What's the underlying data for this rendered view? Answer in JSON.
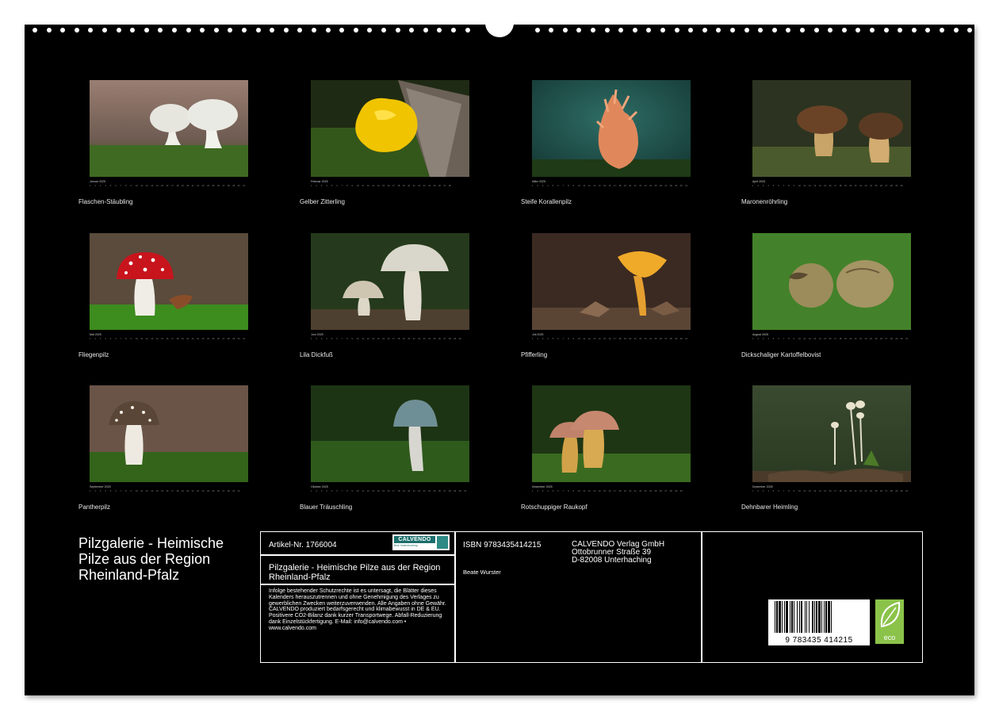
{
  "months": [
    {
      "month_label": "Januar 2025",
      "caption": "Flaschen-Stäubling",
      "days": 31
    },
    {
      "month_label": "Februar 2025",
      "caption": "Gelber Zitterling",
      "days": 28
    },
    {
      "month_label": "März 2025",
      "caption": "Steife Korallenpilz",
      "days": 31
    },
    {
      "month_label": "April 2025",
      "caption": "Maronenröhrling",
      "days": 30
    },
    {
      "month_label": "Mai 2025",
      "caption": "Fliegenpilz",
      "days": 31
    },
    {
      "month_label": "Juni 2025",
      "caption": "Lila Dickfuß",
      "days": 30
    },
    {
      "month_label": "Juli 2025",
      "caption": "Pfifferling",
      "days": 31
    },
    {
      "month_label": "August 2025",
      "caption": "Dickschaliger Kartoffelbovist",
      "days": 31
    },
    {
      "month_label": "September 2025",
      "caption": "Pantherpilz",
      "days": 30
    },
    {
      "month_label": "Oktober 2025",
      "caption": "Blauer Träuschling",
      "days": 31
    },
    {
      "month_label": "November 2025",
      "caption": "Rotschuppiger Raukopf",
      "days": 30
    },
    {
      "month_label": "Dezember 2025",
      "caption": "Dehnbarer Heimling",
      "days": 31
    }
  ],
  "title": "Pilzgalerie - Heimische Pilze aus der Region Rheinland-Pfalz",
  "info": {
    "article_no": "Artikel-Nr. 1766004",
    "logo_text": "CALVENDO",
    "logo_sub": "Best. Kalenderverlag",
    "product_title": "Pilzgalerie - Heimische Pilze aus der Region Rheinland-Pfalz",
    "legal": "Infolge bestehender Schutzrechte ist es untersagt, die Blätter dieses Kalenders herauszutrennen und ohne Genehmigung des Verlages zu gewerblichen Zwecken weiterzuverwenden. Alle Angaben ohne Gewähr. CALVENDO produziert bedarfsgerecht und klimabewusst in DE & EU. Positivere CO2-Bilanz dank kurzer Transportwege. Abfall-Reduzierung dank Einzelstückfertigung. E-Mail: info@calvendo.com • www.calvendo.com",
    "isbn": "ISBN 9783435414215",
    "author": "Beate Wurster",
    "publisher_line1": "CALVENDO Verlag GmbH",
    "publisher_line2": "Ottobrunner Straße 39",
    "publisher_line3": "D-82008 Unterhaching",
    "barcode_digits": "9 783435 414215",
    "eco_label": "eco"
  },
  "colors": {
    "sheet": "#000000",
    "paper": "#ffffff",
    "eco": "#8bc34a",
    "logo": "#1b6f6c"
  }
}
